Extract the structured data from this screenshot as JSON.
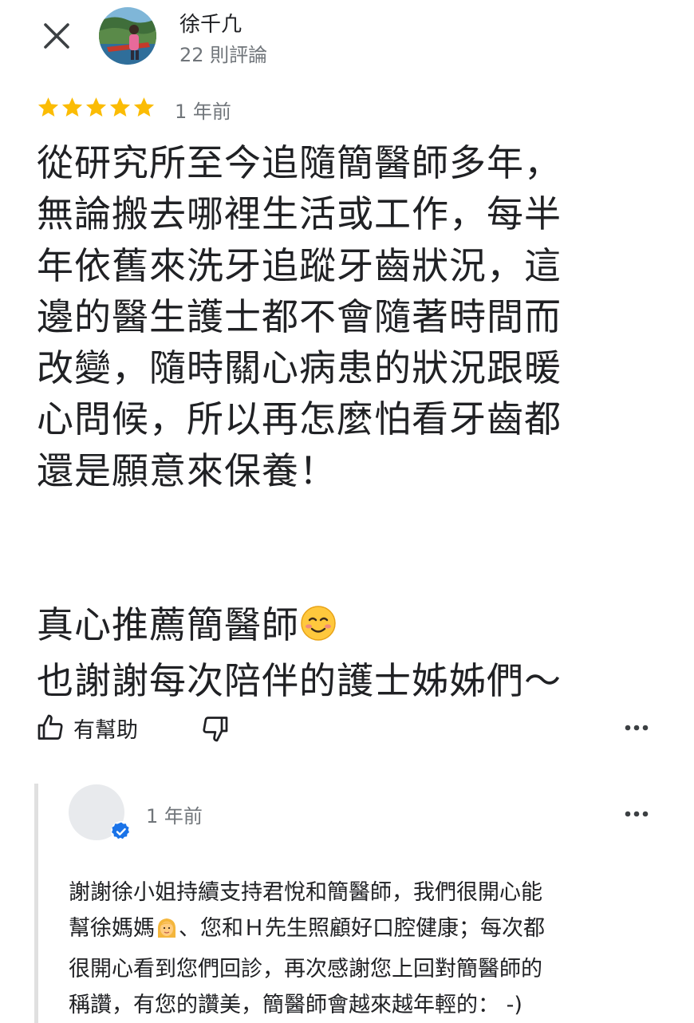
{
  "header": {
    "close_icon": "close-icon",
    "reviewer_name": "徐千凢",
    "review_count": "22 則評論"
  },
  "review": {
    "rating": 5,
    "rating_max": 5,
    "star_color": "#fbbc04",
    "time": "1 年前",
    "paragraph1": "從研究所至今追隨簡醫師多年，\n無論搬去哪裡生活或工作，每半\n年依舊來洗牙追蹤牙齒狀況，這\n邊的醫生護士都不會隨著時間而\n改變，隨時關心病患的狀況跟暖\n心問候，所以再怎麼怕看牙齒都\n還是願意來保養！",
    "paragraph2_line1": "真心推薦簡醫師",
    "paragraph2_line1_emoji": "☺️",
    "paragraph2_line2": "也謝謝每次陪伴的護士姊姊們～"
  },
  "actions": {
    "helpful_label": "有幫助",
    "thumbs_up_icon": "thumbs-up-icon",
    "thumbs_down_icon": "thumbs-down-icon",
    "more_icon": "more-horizontal-icon"
  },
  "owner_reply": {
    "time": "1 年前",
    "verified_color": "#1a73e8",
    "text_part1": "謝謝徐小姐持續支持君悅和簡醫師，我們很開心能\n幫徐媽媽",
    "emoji": "👩",
    "text_part2": "、您和Ｈ先生照顧好口腔健康；每次都\n很開心看到您們回診，再次感謝您上回對簡醫師的\n稱讚，有您的讚美，簡醫師會越來越年輕的： -)"
  }
}
